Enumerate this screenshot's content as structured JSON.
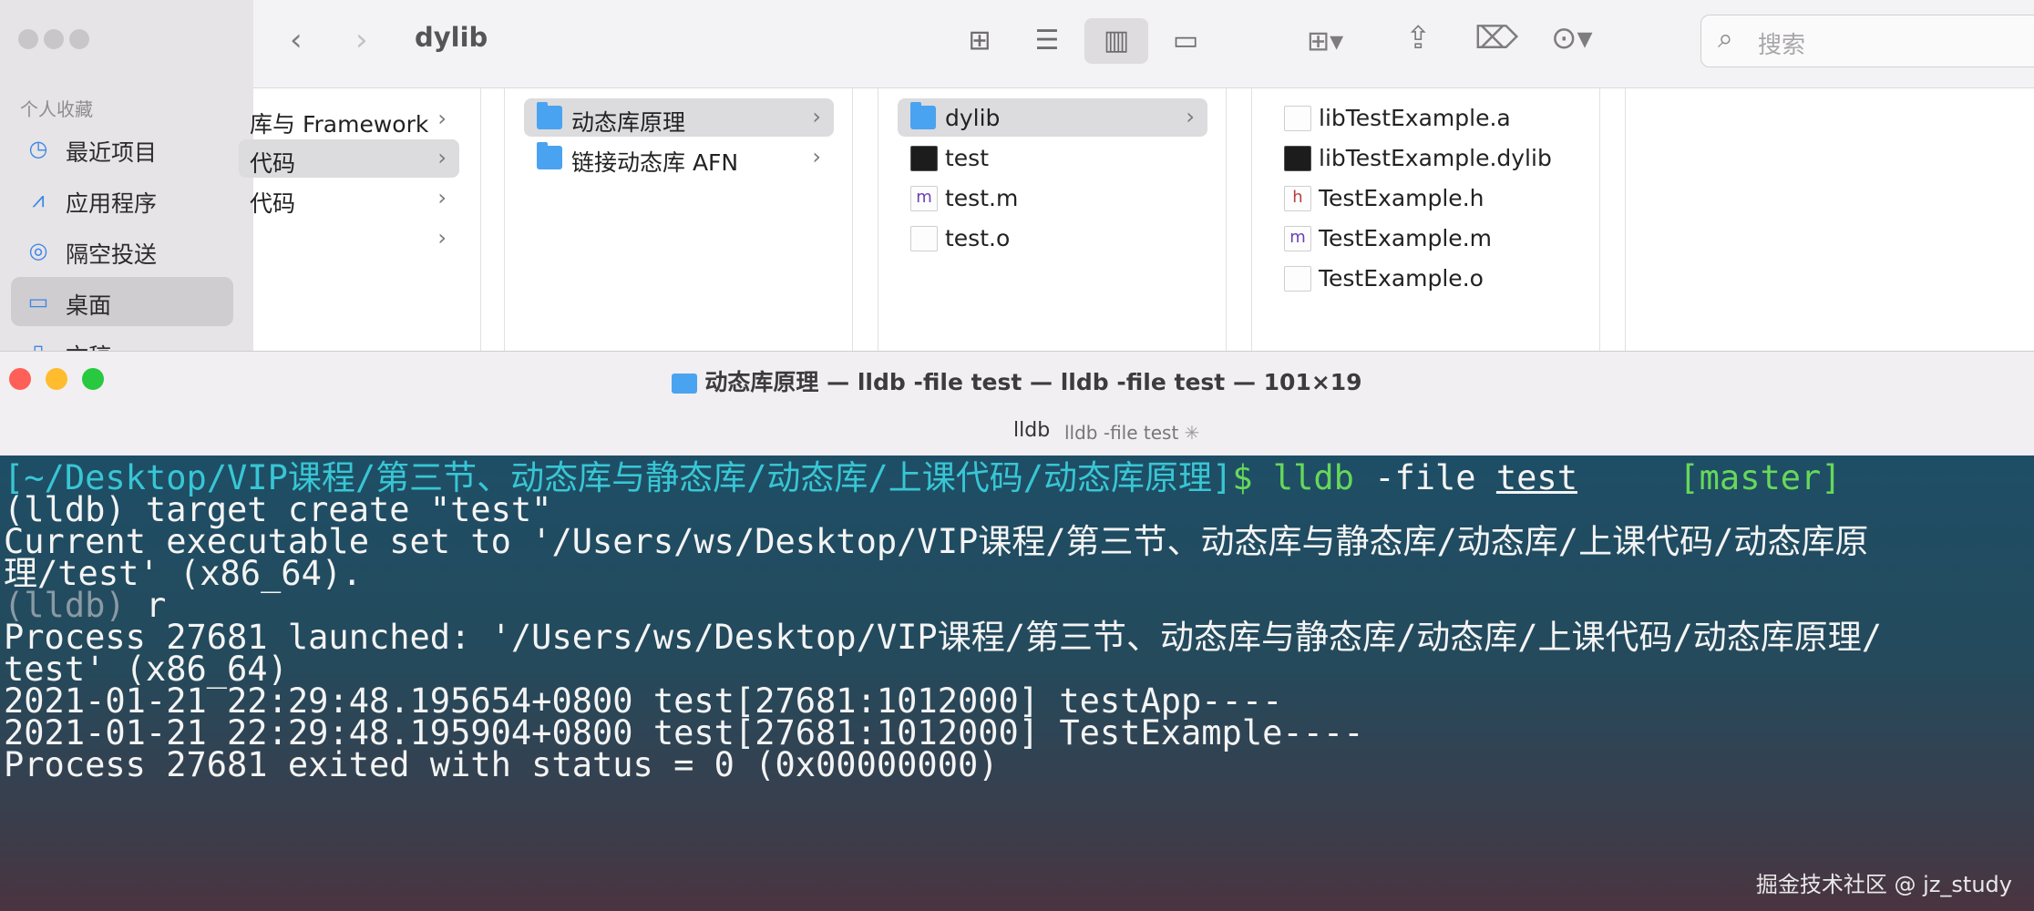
{
  "finder": {
    "path_title": "dylib",
    "sidebar": {
      "section": "个人收藏",
      "items": [
        {
          "icon": "clock-icon",
          "label": "最近项目"
        },
        {
          "icon": "apps-icon",
          "label": "应用程序"
        },
        {
          "icon": "airdrop-icon",
          "label": "隔空投送"
        },
        {
          "icon": "desktop-icon",
          "label": "桌面"
        },
        {
          "icon": "document-icon",
          "label": "文稿"
        }
      ]
    },
    "search": {
      "placeholder": "搜索"
    },
    "columns": [
      {
        "rows": [
          {
            "label": "库与 Framework",
            "chevron": true
          },
          {
            "label": "代码",
            "chevron": true,
            "selected": true
          },
          {
            "label": "代码",
            "chevron": true
          },
          {
            "label": "",
            "chevron": true
          }
        ]
      },
      {
        "rows": [
          {
            "label": "动态库原理",
            "type": "folder",
            "selected": true
          },
          {
            "label": "链接动态库 AFN",
            "type": "folder"
          }
        ]
      },
      {
        "rows": [
          {
            "label": "dylib",
            "type": "folder",
            "selected": true
          },
          {
            "label": "test",
            "type": "executable"
          },
          {
            "label": "test.m",
            "type": "m-file"
          },
          {
            "label": "test.o",
            "type": "file"
          }
        ]
      },
      {
        "rows": [
          {
            "label": "libTestExample.a",
            "type": "file"
          },
          {
            "label": "libTestExample.dylib",
            "type": "executable"
          },
          {
            "label": "TestExample.h",
            "type": "h-file"
          },
          {
            "label": "TestExample.m",
            "type": "m-file"
          },
          {
            "label": "TestExample.o",
            "type": "file"
          }
        ]
      }
    ]
  },
  "terminal": {
    "title": "动态库原理 — lldb -file test — lldb -file test — 101×19",
    "tab_label": "lldb",
    "tab_sub": "lldb -file test",
    "prompt": "[~/Desktop/VIP课程/第三节、动态库与静态库/动态库/上课代码/动态库原理]",
    "prompt_symbol": "$",
    "command": "lldb",
    "command_arg": "-file",
    "command_file": "test",
    "branch": "[master]",
    "lines": [
      "(lldb) target create \"test\"",
      "Current executable set to '/Users/ws/Desktop/VIP课程/第三节、动态库与静态库/动态库/上课代码/动态库原",
      "理/test' (x86_64).",
      "r",
      "Process 27681 launched: '/Users/ws/Desktop/VIP课程/第三节、动态库与静态库/动态库/上课代码/动态库原理/",
      "test' (x86_64)",
      "2021-01-21 22:29:48.195654+0800 test[27681:1012000] testApp----",
      "2021-01-21 22:29:48.195904+0800 test[27681:1012000] TestExample----",
      "Process 27681 exited with status = 0 (0x00000000)"
    ],
    "lldb_prompt": "(lldb)"
  },
  "watermark": "掘金技术社区 @ jz_study",
  "colors": {
    "accent": "#4aa3f0",
    "term_prompt": "#38c6d4",
    "term_green": "#66d85a"
  }
}
